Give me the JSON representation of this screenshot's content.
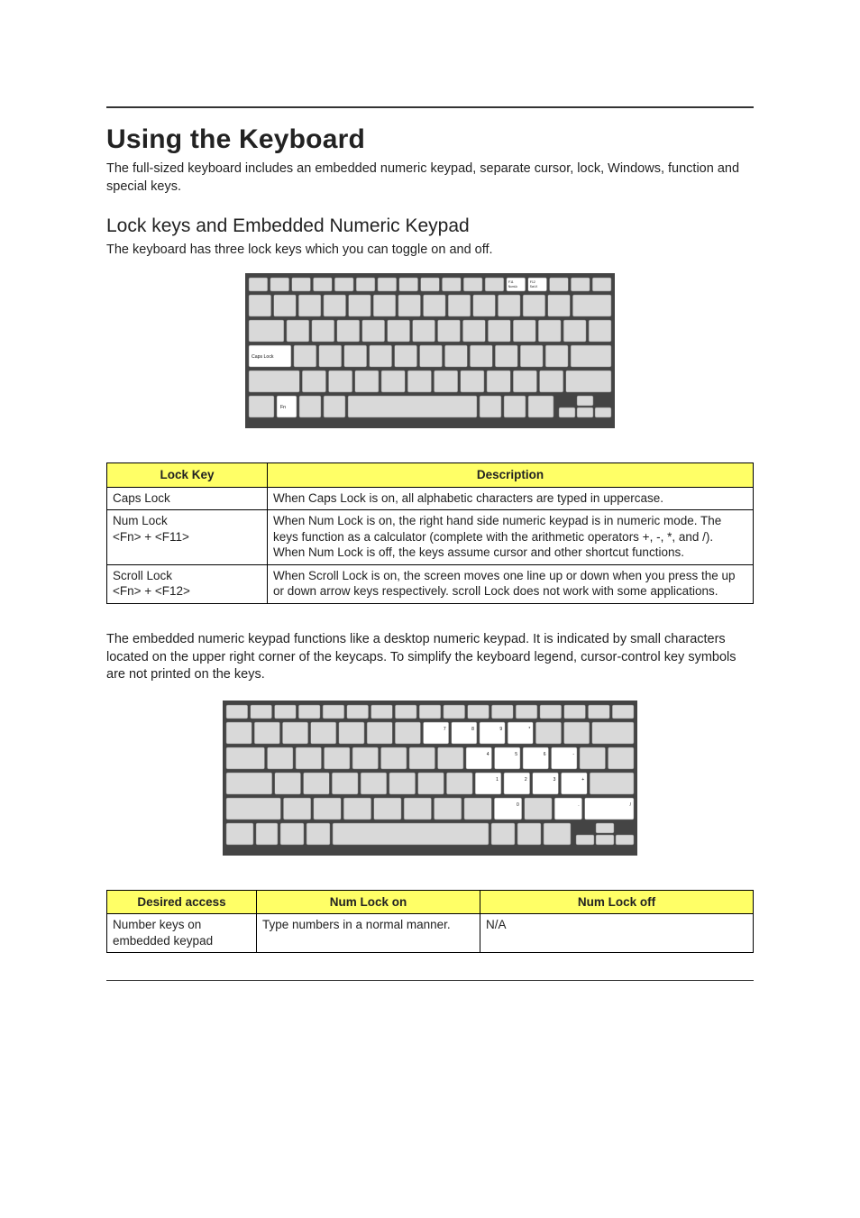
{
  "heading": "Using the Keyboard",
  "intro": "The full-sized keyboard includes an embedded numeric keypad, separate cursor, lock, Windows, function and special keys.",
  "subheading": "Lock keys and Embedded Numeric Keypad",
  "subtext": "The keyboard has three lock keys which you can toggle on and off.",
  "keyboard1_labels": {
    "capslock": "Caps Lock",
    "fn": "Fn",
    "f11_top": "F11",
    "f11_bottom": "NumLk",
    "f12_top": "F12",
    "f12_bottom": "ScrLK"
  },
  "lock_table": {
    "headers": [
      "Lock Key",
      "Description"
    ],
    "rows": [
      {
        "key": "Caps Lock",
        "desc": "When Caps Lock is on, all alphabetic characters are typed in uppercase."
      },
      {
        "key": "Num Lock\n<Fn> + <F11>",
        "desc": "When Num Lock is on, the right hand side numeric keypad is in numeric mode. The keys function as a calculator (complete with the arithmetic operators +, -, *, and /). When Num Lock is off, the keys assume cursor and other shortcut functions."
      },
      {
        "key": "Scroll Lock\n<Fn> + <F12>",
        "desc": "When Scroll Lock is on, the screen moves one line up or down when you press the up or down arrow keys respectively. scroll Lock does not work with some applications."
      }
    ]
  },
  "after_table_text": "The embedded numeric keypad functions like a desktop numeric keypad. It is indicated by small characters located on the upper right corner of the keycaps. To simplify the keyboard legend, cursor-control key symbols are not printed on the keys.",
  "keyboard2_labels": {
    "r1": [
      "7",
      "8",
      "9",
      "*"
    ],
    "r2": [
      "4",
      "5",
      "6",
      "-"
    ],
    "r3": [
      "1",
      "2",
      "3",
      "+"
    ],
    "r4": [
      "0",
      ".",
      "/"
    ]
  },
  "access_table": {
    "headers": [
      "Desired access",
      "Num Lock on",
      "Num Lock off"
    ],
    "rows": [
      {
        "c1": "Number keys on embedded keypad",
        "c2": "Type numbers in a normal manner.",
        "c3": "N/A"
      }
    ]
  }
}
